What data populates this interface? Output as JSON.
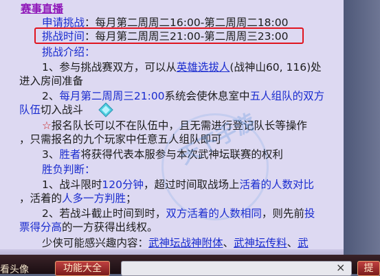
{
  "section_title": "赛事直播",
  "apply": {
    "label": "申请挑战",
    "sep": "：",
    "text": "每月第二周周二16:00-第二周周二18:00"
  },
  "challenge": {
    "label": "挑战时间",
    "sep": "：",
    "text": "每月第二周周三21:00-第二周周三23:00"
  },
  "intro_label": "挑战介绍：",
  "item1": {
    "pre": "1、参与挑战赛双方，可以从",
    "link": "英雄选拔人",
    "post": "(战神山60, 116)处",
    "cont": "进入房间准备"
  },
  "item2": {
    "num": "2、",
    "time": "每月第二周周三21:00",
    "mid": "系统会使休息室中",
    "group": "五人组队的双方",
    "group2": "队伍",
    "tail": "切入战斗"
  },
  "note": {
    "star": "☆",
    "line1": "报名队长可以不在队伍中，且无需进行登记队长等操作",
    "line2": "，只需报名的九个玩家中任意五人组队即可"
  },
  "item3": {
    "pre": "3、",
    "winner": "胜者",
    "post": "将获得代表本服参与本次武神坛联赛的权利"
  },
  "judge_label": "胜负判断：",
  "judge1": {
    "pre": "1、战斗限时",
    "dur": "120分钟",
    "mid": "，超过时间取战场上",
    "alive": "活着的人数对比",
    "cont_pre": "，活着的",
    "more": "人多一方判胜",
    "cont_post": "；"
  },
  "judge2": {
    "pre": "2、若战斗截止时间到时，",
    "same": "双方活着的人数相同",
    "mid": "，则先前",
    "out": "投",
    "cont_blue": "票得分高",
    "cont_post": "的一方获得出线权。"
  },
  "interest": {
    "label": "少侠可能感兴趣内容：",
    "link1": "武神坛战神附体",
    "sep": "、",
    "link2": "武神坛传料",
    "sep2": "、",
    "link3": "武"
  },
  "watermark": "天下手游",
  "bottom": {
    "left_label": "看头像",
    "func_button": "功能大全",
    "input_value": "",
    "clear": "×",
    "submit": "提"
  },
  "colors": {
    "panel": "#ddd9f2",
    "highlight_border": "#e0141e",
    "link_blue": "#1a2ccf",
    "accent_red": "#c81e1e"
  }
}
